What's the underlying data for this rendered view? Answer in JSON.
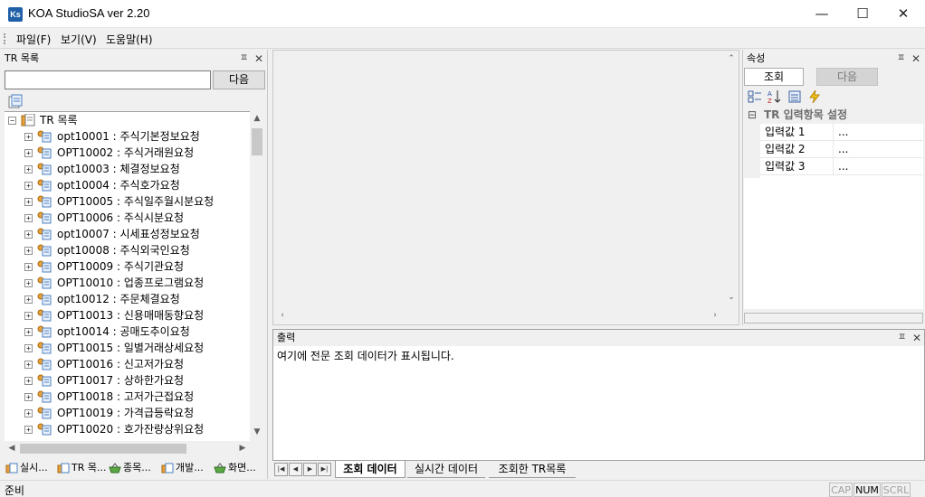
{
  "window": {
    "icon_text": "Ks",
    "title": "KOA StudioSA ver 2.20",
    "controls": {
      "minimize": "—",
      "maximize": "☐",
      "close": "✕"
    }
  },
  "menu": {
    "items": [
      "파일(F)",
      "보기(V)",
      "도움말(H)"
    ]
  },
  "tr_panel": {
    "title": "TR 목록",
    "search_value": "",
    "next_label": "다음",
    "root_label": "TR 목록",
    "items": [
      "opt10001 : 주식기본정보요청",
      "OPT10002 : 주식거래원요청",
      "opt10003 : 체결정보요청",
      "opt10004 : 주식호가요청",
      "OPT10005 : 주식일주월시분요청",
      "OPT10006 : 주식시분요청",
      "opt10007 : 시세표성정보요청",
      "opt10008 : 주식외국인요청",
      "OPT10009 : 주식기관요청",
      "OPT10010 : 업종프로그램요청",
      "opt10012 : 주문체결요청",
      "OPT10013 : 신용매매동향요청",
      "opt10014 : 공매도추이요청",
      "OPT10015 : 일별거래상세요청",
      "OPT10016 : 신고저가요청",
      "OPT10017 : 상하한가요청",
      "OPT10018 : 고저가근접요청",
      "OPT10019 : 가격급등락요청",
      "OPT10020 : 호가잔량상위요청"
    ],
    "bottom_tabs": [
      "실시...",
      "TR 목...",
      "종목...",
      "개발...",
      "화면..."
    ]
  },
  "properties_panel": {
    "title": "속성",
    "tabs": [
      "조회",
      "다음"
    ],
    "category": "TR 입력항목 설정",
    "rows": [
      {
        "name": "입력값 1",
        "value": "..."
      },
      {
        "name": "입력값 2",
        "value": "..."
      },
      {
        "name": "입력값 3",
        "value": "..."
      }
    ]
  },
  "output_panel": {
    "title": "출력",
    "text": "여기에 전문 조회 데이터가 표시됩니다.",
    "tabs": [
      "조회 데이터",
      "실시간 데이터",
      "조회한 TR목록"
    ]
  },
  "status_bar": {
    "text": "준비",
    "indicators": [
      "CAP",
      "NUM",
      "SCRL"
    ]
  },
  "colors": {
    "accent": "#1f5fa8",
    "folder": "#e8a13a",
    "doc": "#4a7fc1"
  }
}
